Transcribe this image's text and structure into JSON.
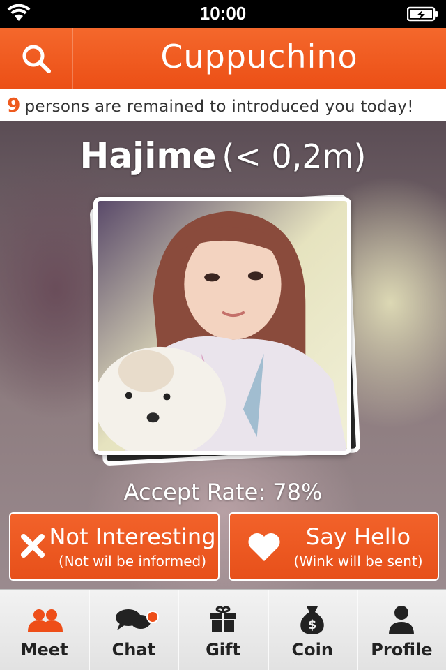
{
  "status_bar": {
    "time": "10:00"
  },
  "header": {
    "title": "Cuppuchino"
  },
  "notice": {
    "count": "9",
    "message": "persons are remained to introduced you today!"
  },
  "profile": {
    "name": "Hajime",
    "distance": "(< 0,2m)",
    "accept_rate": "Accept Rate: 78%"
  },
  "actions": {
    "not_interesting": {
      "label": "Not Interesting",
      "sub": "(Not wil be informed)"
    },
    "say_hello": {
      "label": "Say Hello",
      "sub": "(Wink will be sent)"
    }
  },
  "tabs": [
    {
      "label": "Meet",
      "icon": "people-icon"
    },
    {
      "label": "Chat",
      "icon": "chat-bubbles-icon"
    },
    {
      "label": "Gift",
      "icon": "gift-icon"
    },
    {
      "label": "Coin",
      "icon": "money-bag-icon"
    },
    {
      "label": "Profile",
      "icon": "person-icon"
    }
  ],
  "colors": {
    "accent": "#ee5a1e",
    "tab_active": "#ee4e18"
  }
}
